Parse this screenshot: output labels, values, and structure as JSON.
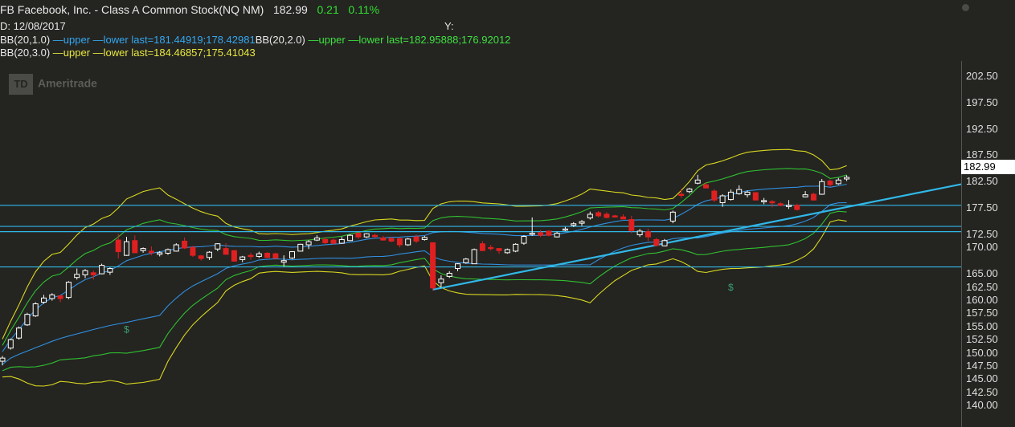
{
  "header": {
    "symbol_line": "FB Facebook, Inc. - Class A Common Stock(NQ NM)",
    "last": "182.99",
    "change": "0.21",
    "change_pct": "0.11%",
    "date_label": "D:",
    "date": "12/08/2017",
    "y_label": "Y:",
    "bb1_label": "BB(20,1.0)",
    "bb1_upper": "upper",
    "bb1_lower": "lower",
    "bb1_last": "last=181.44919;178.42981",
    "bb2_label": "BB(20,2.0)",
    "bb2_upper": "upper",
    "bb2_lower": "lower",
    "bb2_last": "last=182.95888;176.92012",
    "bb3_label": "BB(20,3.0)",
    "bb3_upper": "upper",
    "bb3_lower": "lower",
    "bb3_last": "last=184.46857;175.41043"
  },
  "branding": {
    "logo_mark": "TD",
    "logo_text": "Ameritrade"
  },
  "current_price_label": "182.99",
  "chart_data": {
    "type": "candlestick",
    "ylim": [
      138.7,
      205.5
    ],
    "yticks": [
      "202.50",
      "197.50",
      "192.50",
      "187.50",
      "182.50",
      "177.50",
      "172.50",
      "170.00",
      "165.00",
      "162.50",
      "160.00",
      "157.50",
      "155.00",
      "152.50",
      "150.00",
      "147.50",
      "145.00",
      "142.50",
      "140.00"
    ],
    "colors": {
      "up": "#ffffff",
      "down": "#e02020",
      "bb1": "#2f90e0",
      "bb2": "#30c030",
      "bb3": "#d8d820",
      "level": "#30b8e8",
      "trend": "#30b8e8",
      "background": "#242421"
    },
    "levels": [
      178.0,
      174.0,
      173.0,
      166.3
    ],
    "trendline": {
      "from": [
        0,
        162.0
      ],
      "to": [
        0,
        182.0
      ]
    },
    "markers": [
      "$",
      "$"
    ],
    "candles": [
      [
        148.4,
        149.4,
        147.6,
        149.0
      ],
      [
        150.9,
        152.7,
        150.6,
        152.5
      ],
      [
        152.8,
        155.0,
        152.5,
        154.7
      ],
      [
        155.3,
        157.6,
        155.1,
        157.3
      ],
      [
        157.0,
        159.6,
        156.8,
        159.3
      ],
      [
        159.6,
        161.0,
        159.3,
        160.4
      ],
      [
        160.3,
        161.3,
        159.9,
        161.0
      ],
      [
        160.8,
        161.0,
        159.6,
        160.3
      ],
      [
        160.5,
        163.6,
        160.2,
        163.4
      ],
      [
        164.3,
        166.0,
        163.9,
        164.9
      ],
      [
        164.8,
        165.9,
        164.2,
        165.6
      ],
      [
        165.2,
        165.6,
        163.9,
        164.8
      ],
      [
        165.0,
        166.9,
        164.9,
        166.6
      ],
      [
        165.3,
        166.2,
        164.8,
        166.0
      ],
      [
        171.4,
        172.6,
        167.9,
        169.2
      ],
      [
        168.5,
        172.0,
        168.4,
        171.1
      ],
      [
        171.3,
        172.3,
        168.9,
        169.0
      ],
      [
        169.4,
        170.0,
        169.0,
        169.8
      ],
      [
        169.3,
        170.2,
        168.5,
        169.0
      ],
      [
        168.7,
        169.3,
        168.3,
        169.0
      ],
      [
        168.9,
        169.8,
        168.6,
        169.6
      ],
      [
        169.3,
        170.8,
        169.2,
        170.5
      ],
      [
        171.2,
        171.9,
        169.7,
        169.9
      ],
      [
        170.0,
        170.3,
        168.2,
        168.5
      ],
      [
        168.4,
        168.6,
        167.5,
        167.9
      ],
      [
        168.1,
        169.3,
        167.6,
        169.1
      ],
      [
        169.7,
        170.8,
        169.3,
        170.7
      ],
      [
        169.8,
        170.8,
        168.6,
        168.7
      ],
      [
        169.4,
        169.5,
        167.3,
        167.4
      ],
      [
        167.7,
        168.4,
        167.2,
        168.2
      ],
      [
        168.5,
        169.0,
        167.7,
        168.3
      ],
      [
        168.3,
        169.2,
        168.0,
        168.8
      ],
      [
        168.9,
        169.1,
        168.0,
        168.1
      ],
      [
        168.8,
        169.0,
        167.7,
        168.0
      ],
      [
        167.2,
        168.5,
        166.4,
        167.5
      ],
      [
        168.0,
        169.3,
        167.8,
        169.2
      ],
      [
        169.3,
        170.7,
        169.2,
        170.6
      ],
      [
        170.5,
        171.4,
        169.7,
        171.1
      ],
      [
        171.4,
        172.3,
        171.2,
        171.8
      ],
      [
        171.5,
        172.0,
        170.6,
        170.9
      ],
      [
        171.4,
        171.7,
        170.6,
        170.8
      ],
      [
        170.8,
        172.0,
        170.7,
        171.5
      ],
      [
        171.3,
        172.5,
        171.2,
        172.3
      ],
      [
        172.7,
        172.9,
        171.6,
        172.0
      ],
      [
        172.0,
        172.7,
        171.8,
        172.6
      ],
      [
        172.3,
        172.6,
        171.8,
        172.1
      ],
      [
        171.8,
        172.2,
        171.3,
        171.4
      ],
      [
        171.7,
        172.0,
        171.0,
        171.2
      ],
      [
        171.7,
        171.8,
        170.0,
        170.5
      ],
      [
        170.5,
        171.8,
        170.3,
        171.6
      ],
      [
        172.0,
        172.4,
        170.8,
        171.2
      ],
      [
        171.5,
        172.2,
        171.3,
        171.9
      ],
      [
        170.9,
        170.9,
        161.8,
        162.3
      ],
      [
        163.3,
        164.7,
        162.4,
        164.0
      ],
      [
        164.5,
        165.5,
        164.2,
        165.1
      ],
      [
        166.0,
        167.0,
        165.5,
        166.9
      ],
      [
        167.1,
        168.0,
        166.9,
        167.8
      ],
      [
        166.9,
        169.8,
        166.9,
        169.6
      ],
      [
        170.7,
        171.2,
        169.3,
        169.4
      ],
      [
        170.0,
        170.5,
        169.4,
        169.8
      ],
      [
        169.8,
        169.9,
        168.8,
        169.4
      ],
      [
        169.0,
        169.8,
        168.8,
        169.6
      ],
      [
        169.3,
        170.8,
        169.1,
        170.6
      ],
      [
        170.8,
        172.3,
        170.5,
        172.1
      ],
      [
        172.5,
        175.7,
        172.2,
        172.7
      ],
      [
        172.8,
        173.3,
        172.0,
        172.3
      ],
      [
        173.1,
        173.2,
        172.1,
        172.3
      ],
      [
        172.0,
        173.0,
        171.9,
        172.7
      ],
      [
        173.3,
        173.9,
        173.1,
        173.5
      ],
      [
        174.2,
        174.8,
        173.9,
        174.5
      ],
      [
        174.6,
        175.2,
        174.1,
        174.9
      ],
      [
        175.6,
        176.8,
        175.3,
        176.3
      ],
      [
        176.6,
        176.9,
        175.7,
        176.0
      ],
      [
        176.3,
        176.7,
        175.5,
        175.7
      ],
      [
        176.0,
        176.2,
        175.7,
        175.9
      ],
      [
        175.8,
        176.3,
        175.4,
        175.4
      ],
      [
        175.3,
        176.0,
        172.7,
        173.2
      ],
      [
        172.4,
        173.5,
        172.0,
        173.1
      ],
      [
        173.0,
        173.6,
        171.2,
        172.0
      ],
      [
        171.5,
        171.8,
        170.2,
        170.4
      ],
      [
        170.3,
        171.6,
        170.2,
        171.3
      ],
      [
        175.0,
        177.0,
        174.6,
        176.7
      ],
      [
        180.1,
        181.1,
        179.4,
        180.0
      ],
      [
        180.6,
        181.3,
        180.3,
        181.1
      ],
      [
        182.2,
        183.8,
        182.0,
        182.8
      ],
      [
        181.9,
        182.4,
        181.2,
        181.3
      ],
      [
        180.7,
        181.1,
        178.6,
        179.0
      ],
      [
        178.5,
        180.1,
        177.7,
        179.8
      ],
      [
        179.1,
        181.0,
        178.9,
        180.5
      ],
      [
        180.2,
        181.8,
        180.0,
        181.0
      ],
      [
        180.0,
        180.8,
        179.5,
        180.5
      ],
      [
        180.4,
        180.5,
        178.9,
        179.0
      ],
      [
        178.9,
        179.4,
        178.2,
        178.9
      ],
      [
        178.7,
        179.0,
        177.6,
        178.5
      ],
      [
        178.3,
        178.6,
        177.8,
        178.0
      ],
      [
        177.9,
        179.0,
        177.3,
        178.0
      ],
      [
        178.0,
        178.3,
        177.0,
        177.2
      ],
      [
        179.6,
        180.7,
        179.5,
        180.0
      ],
      [
        180.1,
        180.4,
        178.9,
        179.0
      ],
      [
        180.1,
        183.0,
        180.0,
        182.5
      ],
      [
        182.6,
        182.9,
        181.5,
        181.9
      ],
      [
        182.1,
        183.2,
        181.9,
        182.8
      ],
      [
        183.0,
        183.7,
        182.6,
        183.3
      ]
    ]
  }
}
